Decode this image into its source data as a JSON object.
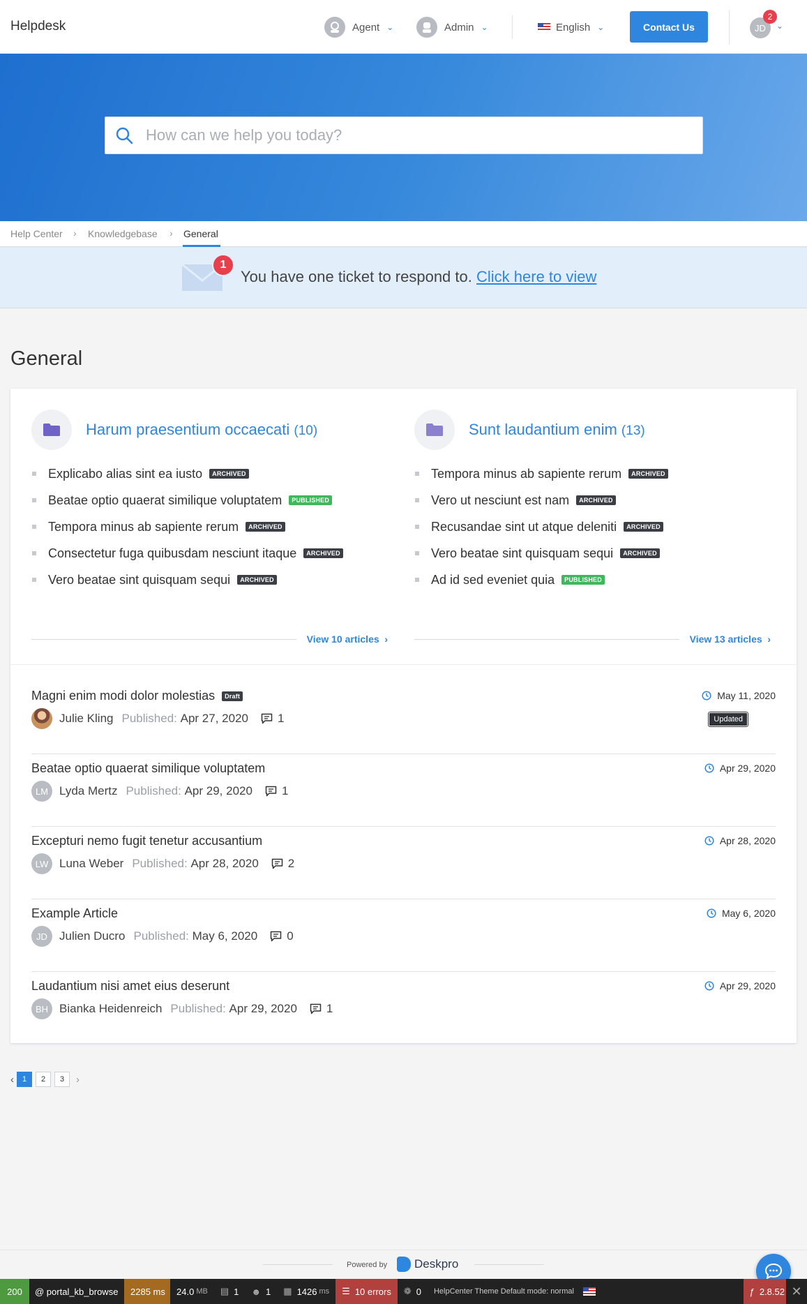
{
  "header": {
    "brand": "Helpdesk",
    "agent_label": "Agent",
    "admin_label": "Admin",
    "language_label": "English",
    "contact_label": "Contact Us",
    "user_initials": "JD",
    "user_badge": "2"
  },
  "hero": {
    "search_placeholder": "How can we help you today?"
  },
  "breadcrumb": {
    "items": [
      "Help Center",
      "Knowledgebase",
      "General"
    ]
  },
  "notice": {
    "badge": "1",
    "text": "You have one ticket to respond to.",
    "link": "Click here to view"
  },
  "page": {
    "title": "General"
  },
  "categories": [
    {
      "title": "Harum praesentium occaecati",
      "count": "(10)",
      "view_label": "View 10 articles",
      "articles": [
        {
          "title": "Explicabo alias sint ea iusto",
          "tag": "ARCHIVED"
        },
        {
          "title": "Beatae optio quaerat similique voluptatem",
          "tag": "PUBLISHED"
        },
        {
          "title": "Tempora minus ab sapiente rerum",
          "tag": "ARCHIVED"
        },
        {
          "title": "Consectetur fuga quibusdam nesciunt itaque",
          "tag": "ARCHIVED"
        },
        {
          "title": "Vero beatae sint quisquam sequi",
          "tag": "ARCHIVED"
        }
      ]
    },
    {
      "title": "Sunt laudantium enim",
      "count": "(13)",
      "view_label": "View 13 articles",
      "articles": [
        {
          "title": "Tempora minus ab sapiente rerum",
          "tag": "ARCHIVED"
        },
        {
          "title": "Vero ut nesciunt est nam",
          "tag": "ARCHIVED"
        },
        {
          "title": "Recusandae sint ut atque deleniti",
          "tag": "ARCHIVED"
        },
        {
          "title": "Vero beatae sint quisquam sequi",
          "tag": "ARCHIVED"
        },
        {
          "title": "Ad id sed eveniet quia",
          "tag": "PUBLISHED"
        }
      ]
    }
  ],
  "articles": [
    {
      "title": "Magni enim modi dolor molestias",
      "tag": "Draft",
      "author": "Julie Kling",
      "initials": "",
      "published_label": "Published:",
      "published": "Apr 27, 2020",
      "comments": "1",
      "date": "May 11, 2020",
      "tooltip": "Updated"
    },
    {
      "title": "Beatae optio quaerat similique voluptatem",
      "author": "Lyda Mertz",
      "initials": "LM",
      "published_label": "Published:",
      "published": "Apr 29, 2020",
      "comments": "1",
      "date": "Apr 29, 2020"
    },
    {
      "title": "Excepturi nemo fugit tenetur accusantium",
      "author": "Luna Weber",
      "initials": "LW",
      "published_label": "Published:",
      "published": "Apr 28, 2020",
      "comments": "2",
      "date": "Apr 28, 2020"
    },
    {
      "title": "Example Article",
      "author": "Julien Ducro",
      "initials": "JD",
      "published_label": "Published:",
      "published": "May 6, 2020",
      "comments": "0",
      "date": "May 6, 2020"
    },
    {
      "title": "Laudantium nisi amet eius deserunt",
      "author": "Bianka Heidenreich",
      "initials": "BH",
      "published_label": "Published:",
      "published": "Apr 29, 2020",
      "comments": "1",
      "date": "Apr 29, 2020"
    }
  ],
  "pagination": {
    "pages": [
      "1",
      "2",
      "3"
    ],
    "current": "1"
  },
  "footer": {
    "powered_by": "Powered by",
    "brand": "Deskpro"
  },
  "debug_bar": {
    "status": "200",
    "route": "@ portal_kb_browse",
    "time": "2285 ms",
    "memory": "24.0",
    "memory_unit": "MB",
    "forms": "1",
    "user": "1",
    "render_time": "1426",
    "render_unit": "ms",
    "errors": "10 errors",
    "events": "0",
    "theme": "HelpCenter Theme Default mode: normal",
    "version": "2.8.52"
  },
  "colors": {
    "accent": "#2e86de",
    "badge": "#e83f4d",
    "archived": "#3b3f45",
    "published": "#3fb85c"
  }
}
